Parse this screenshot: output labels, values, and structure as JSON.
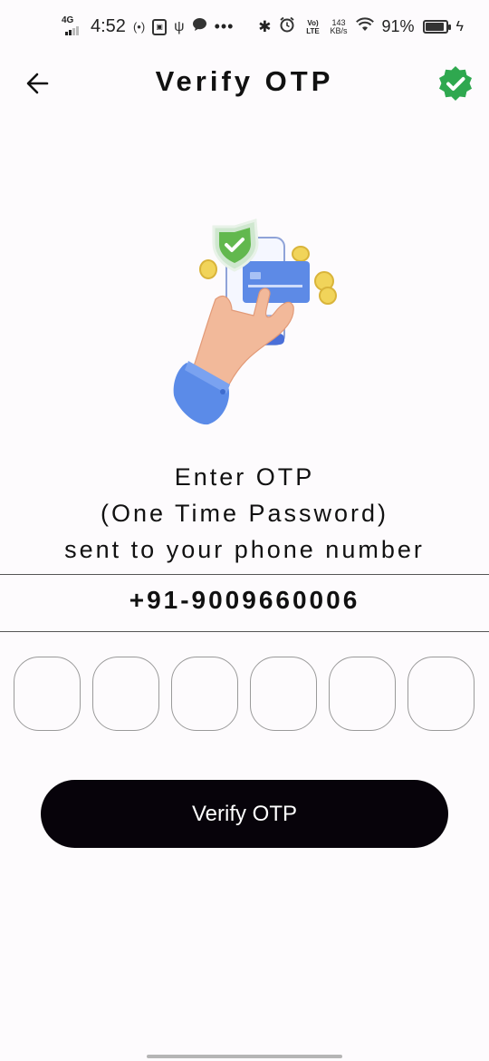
{
  "status_bar": {
    "network": "4G",
    "time": "4:52",
    "volte": "Vo) LTE",
    "speed_value": "143",
    "speed_unit": "KB/s",
    "battery": "91%",
    "battery_level": 0.91
  },
  "header": {
    "title": "Verify OTP",
    "back_icon": "arrow-left-icon",
    "badge_icon": "verified-badge-icon",
    "badge_color": "#2fa84f"
  },
  "instructions": {
    "line1": "Enter OTP",
    "line2": "(One Time Password)",
    "line3": "sent to your phone number"
  },
  "phone_number": "+91-9009660006",
  "otp": {
    "digits": [
      "",
      "",
      "",
      "",
      "",
      ""
    ]
  },
  "actions": {
    "verify_label": "Verify OTP"
  },
  "colors": {
    "background": "#fdfbfd",
    "button": "#07030a",
    "button_text": "#ffffff"
  }
}
